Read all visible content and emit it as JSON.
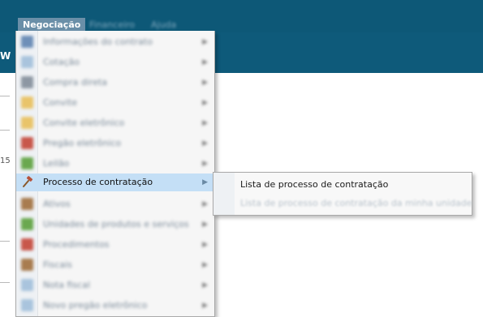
{
  "menubar": {
    "items": [
      {
        "label": "Negociação",
        "active": true
      },
      {
        "label": "Financeiro",
        "active": false
      },
      {
        "label": "Ajuda",
        "active": false
      }
    ]
  },
  "background": {
    "left_letter": "W",
    "left_number": "15"
  },
  "dropdown": {
    "items": [
      {
        "label": "Informações do contrato",
        "icon": "contract-icon",
        "icon_color": "#6e8fb8",
        "has_submenu": true,
        "highlighted": false
      },
      {
        "label": "Cotação",
        "icon": "quote-icon",
        "icon_color": "#a9c4dd",
        "has_submenu": true,
        "highlighted": false
      },
      {
        "label": "Compra direta",
        "icon": "cart-icon",
        "icon_color": "#8d97a3",
        "has_submenu": true,
        "highlighted": false
      },
      {
        "label": "Convite",
        "icon": "folder-icon",
        "icon_color": "#e9c46a",
        "has_submenu": true,
        "highlighted": false
      },
      {
        "label": "Convite eletrônico",
        "icon": "folder-icon",
        "icon_color": "#e9c46a",
        "has_submenu": true,
        "highlighted": false
      },
      {
        "label": "Pregão eletrônico",
        "icon": "gavel-icon",
        "icon_color": "#c8574b",
        "has_submenu": true,
        "highlighted": false
      },
      {
        "label": "Leilão",
        "icon": "auction-icon",
        "icon_color": "#6aa84f",
        "has_submenu": true,
        "highlighted": false
      },
      {
        "label": "Processo de contratação",
        "icon": "hammer-icon",
        "icon_color": "#b5523b",
        "has_submenu": true,
        "highlighted": true
      },
      {
        "label": "Ativos",
        "icon": "box-icon",
        "icon_color": "#a87c4f",
        "has_submenu": true,
        "highlighted": false
      },
      {
        "label": "Unidades de produtos e serviços",
        "icon": "units-icon",
        "icon_color": "#6aa84f",
        "has_submenu": true,
        "highlighted": false
      },
      {
        "label": "Procedimentos",
        "icon": "procedure-icon",
        "icon_color": "#c8574b",
        "has_submenu": true,
        "highlighted": false
      },
      {
        "label": "Fiscais",
        "icon": "fiscal-icon",
        "icon_color": "#a87c4f",
        "has_submenu": true,
        "highlighted": false
      },
      {
        "label": "Nota fiscal",
        "icon": "invoice-icon",
        "icon_color": "#a9c4dd",
        "has_submenu": true,
        "highlighted": false
      },
      {
        "label": "Novo pregão eletrônico",
        "icon": "new-icon",
        "icon_color": "#a9c4dd",
        "has_submenu": true,
        "highlighted": false
      }
    ]
  },
  "submenu": {
    "items": [
      {
        "label": "Lista de processo de contratação",
        "enabled": true
      },
      {
        "label": "Lista de processo de contratação da minha unidade",
        "enabled": false
      }
    ]
  },
  "colors": {
    "header": "#0d5877",
    "active_menu": "#6a8fa8",
    "highlight": "#c4dff6"
  }
}
